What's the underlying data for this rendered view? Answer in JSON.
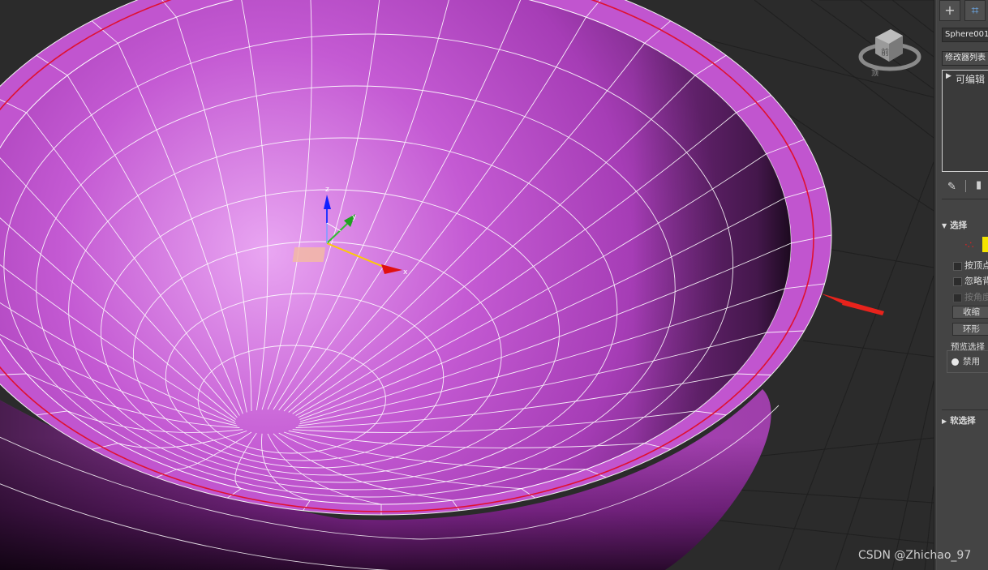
{
  "viewport": {
    "gizmo_axes": {
      "x": "x",
      "y": "y",
      "z": "z"
    },
    "viewcube_label": "前",
    "viewcube_bottom_label": "顶"
  },
  "panel": {
    "object_name": "Sphere001",
    "modifier_list": "修改器列表",
    "stack_item": "可编辑",
    "selection_rollout": "选择",
    "by_vertex": "按顶点",
    "ignore_back": "忽略背",
    "by_angle": "按角度",
    "shrink_button": "收缩",
    "ring_button": "环形",
    "preview_select_label": "预览选择",
    "disable_option": "禁用",
    "soft_select_rollout": "软选择"
  },
  "watermark": "CSDN @Zhichao_97",
  "colors": {
    "bowl": "#c552d2",
    "bowl_light": "#e8a2f0",
    "bowl_dark": "#3a0e3e",
    "selected_edge": "#e01030",
    "arrow": "#e8231c",
    "panel_bg": "#444444"
  }
}
